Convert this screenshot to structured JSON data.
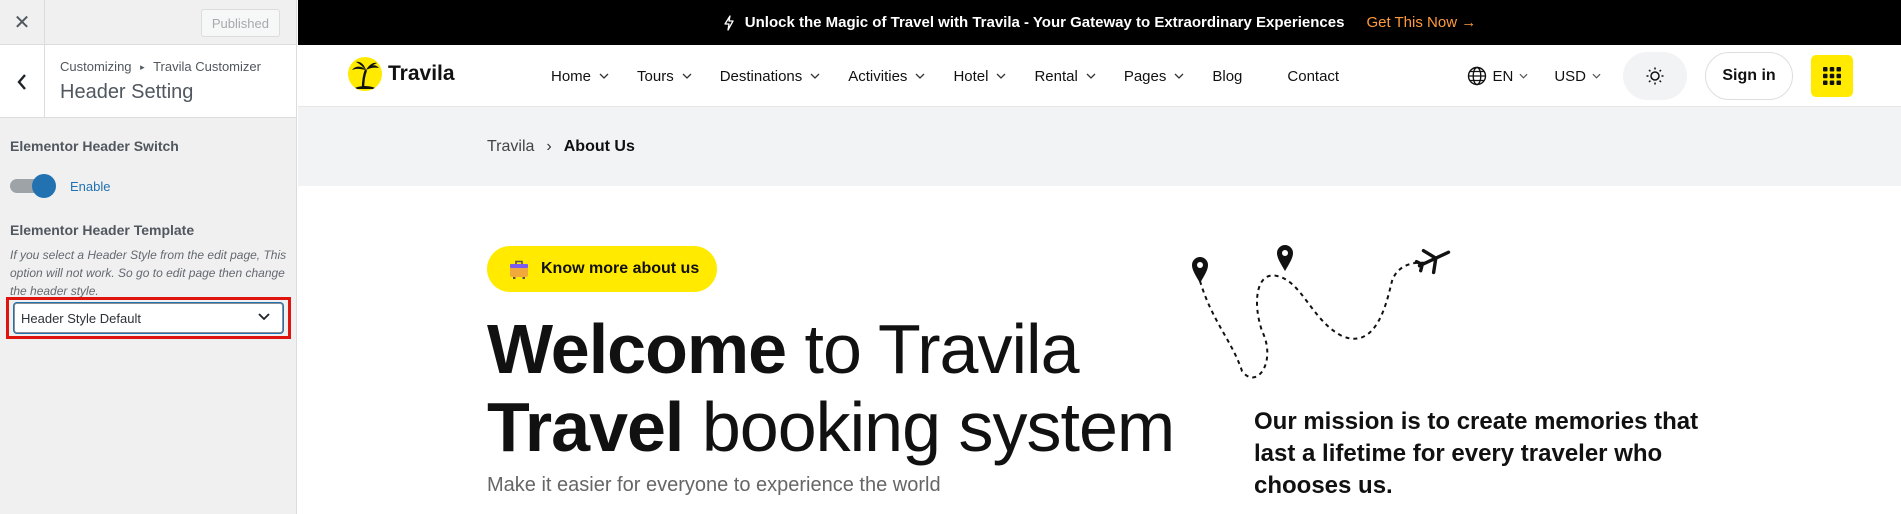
{
  "customizer": {
    "close_label": "✕",
    "publish_label": "Published",
    "breadcrumb_root": "Customizing",
    "breadcrumb_separator": "▸",
    "breadcrumb_child": "Travila Customizer",
    "section_title": "Header Setting",
    "switch_label": "Elementor Header Switch",
    "switch_state_label": "Enable",
    "switch_on": true,
    "template_label": "Elementor Header Template",
    "template_description": "If you select a Header Style from the edit page, This option will not work. So go to edit page then change the header style.",
    "template_selected": "Header Style Default"
  },
  "promo": {
    "text": "Unlock the Magic of Travel with Travila - Your Gateway to Extraordinary Experiences",
    "cta": "Get This Now",
    "cta_arrow": "→",
    "cta_color": "#ff9a3c"
  },
  "header": {
    "logo_text": "Travila",
    "menu": [
      {
        "label": "Home"
      },
      {
        "label": "Tours"
      },
      {
        "label": "Destinations"
      },
      {
        "label": "Activities"
      },
      {
        "label": "Hotel"
      },
      {
        "label": "Rental"
      },
      {
        "label": "Pages"
      },
      {
        "label": "Blog"
      },
      {
        "label": "Contact"
      }
    ],
    "language": "EN",
    "currency": "USD",
    "signin_label": "Sign in",
    "accent_color": "#ffea00"
  },
  "breadcrumb": {
    "home": "Travila",
    "separator": "›",
    "current": "About Us"
  },
  "hero": {
    "badge": "Know more about us",
    "line1_bold": "Welcome",
    "line1_rest": " to Travila",
    "line2_bold": "Travel",
    "line2_rest": " booking system",
    "subtitle": "Make it easier for everyone to experience the world",
    "mission": "Our mission is to create memories that last a lifetime for every traveler who chooses us."
  }
}
